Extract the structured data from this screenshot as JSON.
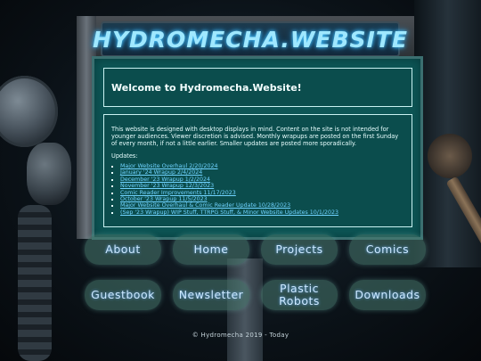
{
  "site": {
    "title": "HYDROMECHA.WEBSITE"
  },
  "welcome": {
    "heading": "Welcome to Hydromecha.Website!"
  },
  "content": {
    "intro": "This website is designed with desktop displays in mind. Content on the site is not intended for younger audiences. Viewer discretion is advised. Monthly wrapups are posted on the first Sunday of every month, if not a little earlier. Smaller updates are posted more sporadically.",
    "updates_label": "Updates:",
    "updates": [
      "Major Website Overhaul 2/20/2024",
      "January '24 Wrapup 2/4/2024",
      "December '23 Wrapup 1/2/2024",
      "November '23 Wrapup 12/3/2023",
      "Comic Reader Improvements 11/17/2023",
      "October '23 Wrapup 11/5/2023",
      "Major Website Overhaul & Comic Reader Update 10/28/2023",
      "(Sep '23 Wrapup) WIP Stuff, TTRPG Stuff, & Minor Website Updates 10/1/2023"
    ]
  },
  "nav": {
    "about": "About",
    "home": "Home",
    "projects": "Projects",
    "comics": "Comics",
    "guestbook": "Guestbook",
    "newsletter": "Newsletter",
    "plastic_robots": "Plastic Robots",
    "downloads": "Downloads"
  },
  "footer": {
    "text": "© Hydromecha 2019 - Today"
  },
  "colors": {
    "screen": "#0d5656",
    "title_glow": "#9fe8ff",
    "link": "#6fd3ff"
  }
}
